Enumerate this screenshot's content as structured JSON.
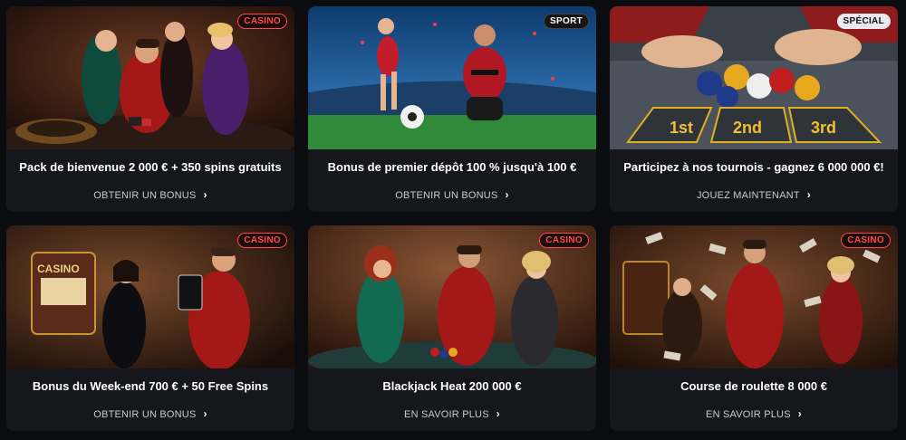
{
  "cards": [
    {
      "badge": "CASINO",
      "title": "Pack de bienvenue 2 000 € + 350 spins gratuits",
      "cta": "OBTENIR UN BONUS",
      "chevron": "›"
    },
    {
      "badge": "SPORT",
      "title": "Bonus de premier dépôt 100 % jusqu'à 100 €",
      "cta": "OBTENIR UN BONUS",
      "chevron": "›"
    },
    {
      "badge": "SPÉCIAL",
      "title": "Participez à nos tournois - gagnez 6 000 000 €!",
      "cta": "JOUEZ MAINTENANT",
      "chevron": "›",
      "table_labels": [
        "1st",
        "2nd",
        "3rd"
      ]
    },
    {
      "badge": "CASINO",
      "title": "Bonus du Week-end 700 € + 50 Free Spins",
      "cta": "OBTENIR UN BONUS",
      "chevron": "›",
      "sign_text": "CASINO"
    },
    {
      "badge": "CASINO",
      "title": "Blackjack Heat 200 000 €",
      "cta": "EN SAVOIR PLUS",
      "chevron": "›"
    },
    {
      "badge": "CASINO",
      "title": "Course de roulette 8 000 €",
      "cta": "EN SAVOIR PLUS",
      "chevron": "›"
    }
  ],
  "colors": {
    "page_bg": "#0b0c10",
    "card_bg": "#16171d",
    "casino_badge": "#ff4a4a",
    "title_text": "#ffffff",
    "cta_text": "#c9cad2"
  }
}
